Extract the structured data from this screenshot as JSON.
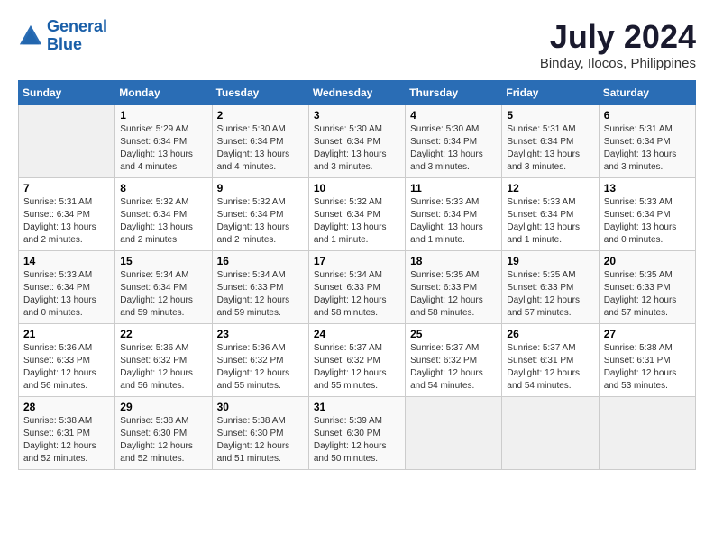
{
  "logo": {
    "line1": "General",
    "line2": "Blue"
  },
  "title": "July 2024",
  "subtitle": "Binday, Ilocos, Philippines",
  "weekdays": [
    "Sunday",
    "Monday",
    "Tuesday",
    "Wednesday",
    "Thursday",
    "Friday",
    "Saturday"
  ],
  "weeks": [
    [
      {
        "day": "",
        "info": ""
      },
      {
        "day": "1",
        "info": "Sunrise: 5:29 AM\nSunset: 6:34 PM\nDaylight: 13 hours\nand 4 minutes."
      },
      {
        "day": "2",
        "info": "Sunrise: 5:30 AM\nSunset: 6:34 PM\nDaylight: 13 hours\nand 4 minutes."
      },
      {
        "day": "3",
        "info": "Sunrise: 5:30 AM\nSunset: 6:34 PM\nDaylight: 13 hours\nand 3 minutes."
      },
      {
        "day": "4",
        "info": "Sunrise: 5:30 AM\nSunset: 6:34 PM\nDaylight: 13 hours\nand 3 minutes."
      },
      {
        "day": "5",
        "info": "Sunrise: 5:31 AM\nSunset: 6:34 PM\nDaylight: 13 hours\nand 3 minutes."
      },
      {
        "day": "6",
        "info": "Sunrise: 5:31 AM\nSunset: 6:34 PM\nDaylight: 13 hours\nand 3 minutes."
      }
    ],
    [
      {
        "day": "7",
        "info": "Sunrise: 5:31 AM\nSunset: 6:34 PM\nDaylight: 13 hours\nand 2 minutes."
      },
      {
        "day": "8",
        "info": "Sunrise: 5:32 AM\nSunset: 6:34 PM\nDaylight: 13 hours\nand 2 minutes."
      },
      {
        "day": "9",
        "info": "Sunrise: 5:32 AM\nSunset: 6:34 PM\nDaylight: 13 hours\nand 2 minutes."
      },
      {
        "day": "10",
        "info": "Sunrise: 5:32 AM\nSunset: 6:34 PM\nDaylight: 13 hours\nand 1 minute."
      },
      {
        "day": "11",
        "info": "Sunrise: 5:33 AM\nSunset: 6:34 PM\nDaylight: 13 hours\nand 1 minute."
      },
      {
        "day": "12",
        "info": "Sunrise: 5:33 AM\nSunset: 6:34 PM\nDaylight: 13 hours\nand 1 minute."
      },
      {
        "day": "13",
        "info": "Sunrise: 5:33 AM\nSunset: 6:34 PM\nDaylight: 13 hours\nand 0 minutes."
      }
    ],
    [
      {
        "day": "14",
        "info": "Sunrise: 5:33 AM\nSunset: 6:34 PM\nDaylight: 13 hours\nand 0 minutes."
      },
      {
        "day": "15",
        "info": "Sunrise: 5:34 AM\nSunset: 6:34 PM\nDaylight: 12 hours\nand 59 minutes."
      },
      {
        "day": "16",
        "info": "Sunrise: 5:34 AM\nSunset: 6:33 PM\nDaylight: 12 hours\nand 59 minutes."
      },
      {
        "day": "17",
        "info": "Sunrise: 5:34 AM\nSunset: 6:33 PM\nDaylight: 12 hours\nand 58 minutes."
      },
      {
        "day": "18",
        "info": "Sunrise: 5:35 AM\nSunset: 6:33 PM\nDaylight: 12 hours\nand 58 minutes."
      },
      {
        "day": "19",
        "info": "Sunrise: 5:35 AM\nSunset: 6:33 PM\nDaylight: 12 hours\nand 57 minutes."
      },
      {
        "day": "20",
        "info": "Sunrise: 5:35 AM\nSunset: 6:33 PM\nDaylight: 12 hours\nand 57 minutes."
      }
    ],
    [
      {
        "day": "21",
        "info": "Sunrise: 5:36 AM\nSunset: 6:33 PM\nDaylight: 12 hours\nand 56 minutes."
      },
      {
        "day": "22",
        "info": "Sunrise: 5:36 AM\nSunset: 6:32 PM\nDaylight: 12 hours\nand 56 minutes."
      },
      {
        "day": "23",
        "info": "Sunrise: 5:36 AM\nSunset: 6:32 PM\nDaylight: 12 hours\nand 55 minutes."
      },
      {
        "day": "24",
        "info": "Sunrise: 5:37 AM\nSunset: 6:32 PM\nDaylight: 12 hours\nand 55 minutes."
      },
      {
        "day": "25",
        "info": "Sunrise: 5:37 AM\nSunset: 6:32 PM\nDaylight: 12 hours\nand 54 minutes."
      },
      {
        "day": "26",
        "info": "Sunrise: 5:37 AM\nSunset: 6:31 PM\nDaylight: 12 hours\nand 54 minutes."
      },
      {
        "day": "27",
        "info": "Sunrise: 5:38 AM\nSunset: 6:31 PM\nDaylight: 12 hours\nand 53 minutes."
      }
    ],
    [
      {
        "day": "28",
        "info": "Sunrise: 5:38 AM\nSunset: 6:31 PM\nDaylight: 12 hours\nand 52 minutes."
      },
      {
        "day": "29",
        "info": "Sunrise: 5:38 AM\nSunset: 6:30 PM\nDaylight: 12 hours\nand 52 minutes."
      },
      {
        "day": "30",
        "info": "Sunrise: 5:38 AM\nSunset: 6:30 PM\nDaylight: 12 hours\nand 51 minutes."
      },
      {
        "day": "31",
        "info": "Sunrise: 5:39 AM\nSunset: 6:30 PM\nDaylight: 12 hours\nand 50 minutes."
      },
      {
        "day": "",
        "info": ""
      },
      {
        "day": "",
        "info": ""
      },
      {
        "day": "",
        "info": ""
      }
    ]
  ]
}
